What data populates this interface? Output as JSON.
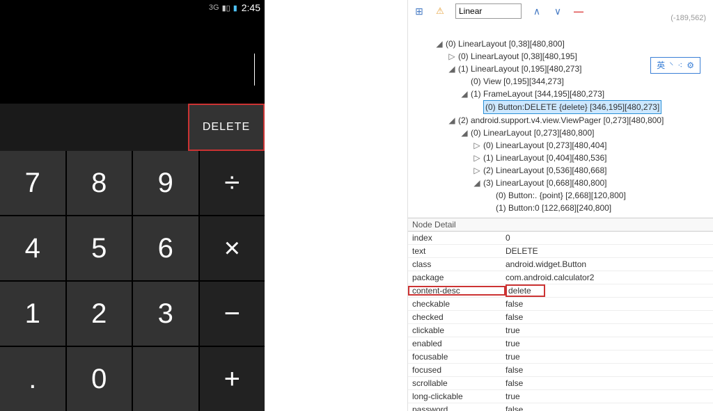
{
  "statusbar": {
    "net": "3G",
    "signal": "▮▯",
    "battery_icon": "▮",
    "clock": "2:45"
  },
  "calc": {
    "delete_label": "DELETE",
    "keys": [
      {
        "label": "7",
        "op": false
      },
      {
        "label": "8",
        "op": false
      },
      {
        "label": "9",
        "op": false
      },
      {
        "label": "÷",
        "op": true
      },
      {
        "label": "4",
        "op": false
      },
      {
        "label": "5",
        "op": false
      },
      {
        "label": "6",
        "op": false
      },
      {
        "label": "×",
        "op": true
      },
      {
        "label": "1",
        "op": false
      },
      {
        "label": "2",
        "op": false
      },
      {
        "label": "3",
        "op": false
      },
      {
        "label": "−",
        "op": true
      },
      {
        "label": ".",
        "op": false
      },
      {
        "label": "0",
        "op": false
      },
      {
        "label": "",
        "op": false
      },
      {
        "label": "+",
        "op": true
      }
    ]
  },
  "toolbar": {
    "search_value": "Linear",
    "coords": "(-189,562)"
  },
  "badge": {
    "t1": "英",
    "t2": "⸌",
    "t3": "⁖",
    "t4": "⚙"
  },
  "tree": [
    {
      "indent": 0,
      "exp": "◢",
      "text": "(0) LinearLayout [0,38][480,800]",
      "sel": false
    },
    {
      "indent": 1,
      "exp": "▷",
      "text": "(0) LinearLayout [0,38][480,195]",
      "sel": false
    },
    {
      "indent": 1,
      "exp": "◢",
      "text": "(1) LinearLayout [0,195][480,273]",
      "sel": false
    },
    {
      "indent": 2,
      "exp": "",
      "text": "(0) View [0,195][344,273]",
      "sel": false
    },
    {
      "indent": 2,
      "exp": "◢",
      "text": "(1) FrameLayout [344,195][480,273]",
      "sel": false
    },
    {
      "indent": 3,
      "exp": "",
      "text": "(0) Button:DELETE {delete} [346,195][480,273]",
      "sel": true
    },
    {
      "indent": 1,
      "exp": "◢",
      "text": "(2) android.support.v4.view.ViewPager [0,273][480,800]",
      "sel": false
    },
    {
      "indent": 2,
      "exp": "◢",
      "text": "(0) LinearLayout [0,273][480,800]",
      "sel": false
    },
    {
      "indent": 3,
      "exp": "▷",
      "text": "(0) LinearLayout [0,273][480,404]",
      "sel": false
    },
    {
      "indent": 3,
      "exp": "▷",
      "text": "(1) LinearLayout [0,404][480,536]",
      "sel": false
    },
    {
      "indent": 3,
      "exp": "▷",
      "text": "(2) LinearLayout [0,536][480,668]",
      "sel": false
    },
    {
      "indent": 3,
      "exp": "◢",
      "text": "(3) LinearLayout [0,668][480,800]",
      "sel": false
    },
    {
      "indent": 4,
      "exp": "",
      "text": "(0) Button:. {point} [2,668][120,800]",
      "sel": false
    },
    {
      "indent": 4,
      "exp": "",
      "text": "(1) Button:0 [122,668][240,800]",
      "sel": false
    }
  ],
  "node_detail_header": "Node Detail",
  "details": [
    {
      "k": "index",
      "v": "0",
      "hl": false
    },
    {
      "k": "text",
      "v": "DELETE",
      "hl": false
    },
    {
      "k": "class",
      "v": "android.widget.Button",
      "hl": false
    },
    {
      "k": "package",
      "v": "com.android.calculator2",
      "hl": false
    },
    {
      "k": "content-desc",
      "v": "delete",
      "hl": true
    },
    {
      "k": "checkable",
      "v": "false",
      "hl": false
    },
    {
      "k": "checked",
      "v": "false",
      "hl": false
    },
    {
      "k": "clickable",
      "v": "true",
      "hl": false
    },
    {
      "k": "enabled",
      "v": "true",
      "hl": false
    },
    {
      "k": "focusable",
      "v": "true",
      "hl": false
    },
    {
      "k": "focused",
      "v": "false",
      "hl": false
    },
    {
      "k": "scrollable",
      "v": "false",
      "hl": false
    },
    {
      "k": "long-clickable",
      "v": "true",
      "hl": false
    },
    {
      "k": "password",
      "v": "false",
      "hl": false
    }
  ]
}
